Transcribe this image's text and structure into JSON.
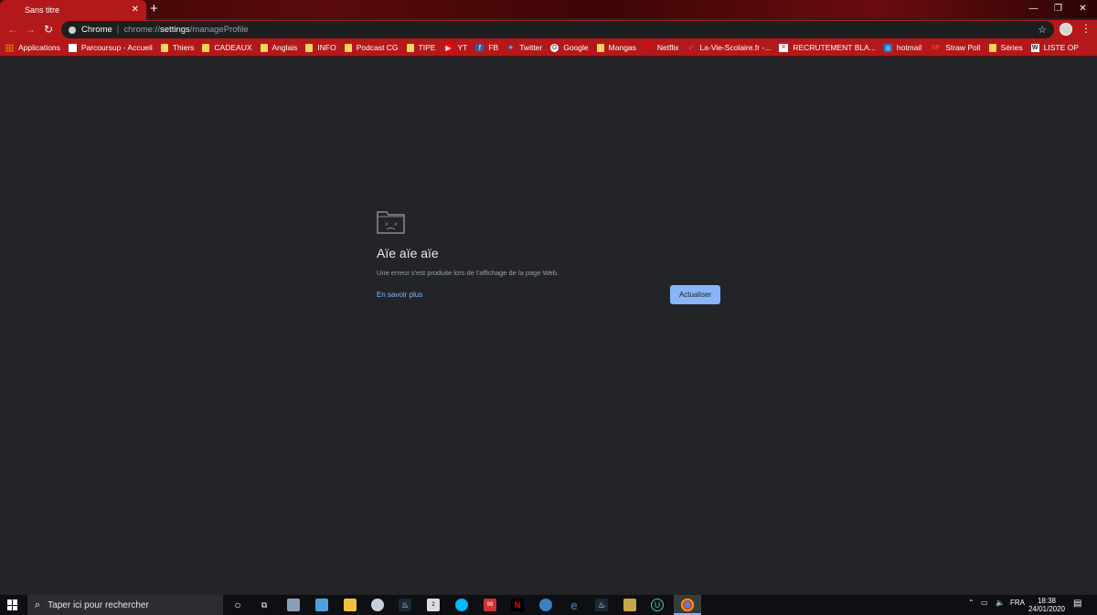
{
  "tab": {
    "title": "Sans titre",
    "close": "✕",
    "new_tab": "+"
  },
  "window_controls": {
    "minimize": "—",
    "maximize": "❐",
    "close": "✕"
  },
  "toolbar": {
    "back": "←",
    "forward": "→",
    "reload": "↻",
    "site_label": "Chrome",
    "url_prefix": "chrome://",
    "url_host": "settings",
    "url_path": "/manageProfile",
    "star": "☆",
    "menu": "⋮"
  },
  "bookmarks": [
    {
      "icon": "grid",
      "label": "Applications"
    },
    {
      "icon": "ps",
      "label": "Parcoursup - Accueil"
    },
    {
      "icon": "folder",
      "label": "Thiers"
    },
    {
      "icon": "folder",
      "label": "CADEAUX"
    },
    {
      "icon": "folder",
      "label": "Anglais"
    },
    {
      "icon": "folder",
      "label": "INFO"
    },
    {
      "icon": "folder",
      "label": "Podcast CG"
    },
    {
      "icon": "folder",
      "label": "TIPE"
    },
    {
      "icon": "yt",
      "label": "YT"
    },
    {
      "icon": "fb",
      "label": "FB"
    },
    {
      "icon": "tw",
      "label": "Twitter"
    },
    {
      "icon": "g",
      "label": "Google"
    },
    {
      "icon": "folder",
      "label": "Mangas"
    },
    {
      "icon": "nf",
      "label": "Netflix"
    },
    {
      "icon": "vs",
      "label": "La-Vie-Scolaire.fr -..."
    },
    {
      "icon": "rec",
      "label": "RECRUTEMENT BLA..."
    },
    {
      "icon": "hm",
      "label": "hotmail"
    },
    {
      "icon": "sp",
      "label": "Straw Poll"
    },
    {
      "icon": "folder",
      "label": "Séries"
    },
    {
      "icon": "w",
      "label": "LISTE OP"
    }
  ],
  "error_page": {
    "title": "Aïe aïe aïe",
    "message": "Une erreur s'est produite lors de l'affichage de la page Web.",
    "learn_more": "En savoir plus",
    "reload_button": "Actualiser"
  },
  "taskbar": {
    "search_placeholder": "Taper ici pour rechercher",
    "language": "FRA",
    "time": "18:38",
    "date": "24/01/2020",
    "mail_badge": "2",
    "app_badge": "99"
  }
}
